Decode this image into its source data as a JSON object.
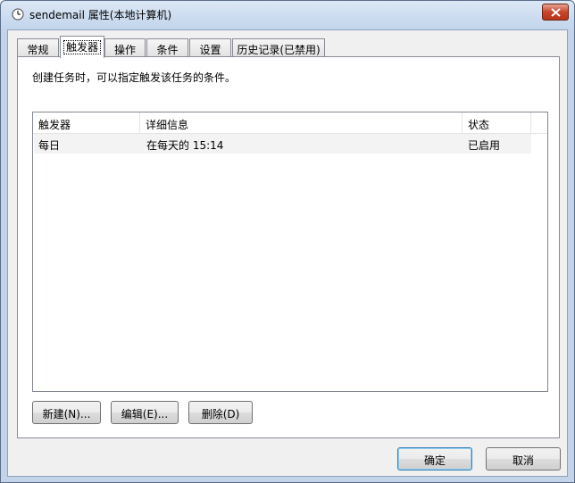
{
  "window": {
    "title": "sendemail 属性(本地计算机)"
  },
  "tabs": [
    {
      "label": "常规"
    },
    {
      "label": "触发器"
    },
    {
      "label": "操作"
    },
    {
      "label": "条件"
    },
    {
      "label": "设置"
    },
    {
      "label": "历史记录(已禁用)"
    }
  ],
  "active_tab": "触发器",
  "panel": {
    "description": "创建任务时，可以指定触发该任务的条件。"
  },
  "list": {
    "columns": [
      "触发器",
      "详细信息",
      "状态"
    ],
    "rows": [
      {
        "trigger": "每日",
        "details": "在每天的 15:14",
        "status": "已启用"
      }
    ]
  },
  "buttons": {
    "new": "新建(N)...",
    "edit": "编辑(E)...",
    "delete": "删除(D)",
    "ok": "确定",
    "cancel": "取消"
  },
  "icons": {
    "title_icon": "clock-icon",
    "close_icon": "close-icon"
  },
  "colors": {
    "window_frame": "#c4d4e8",
    "close_button": "#c7452b",
    "client_bg": "#f0f0f0"
  }
}
